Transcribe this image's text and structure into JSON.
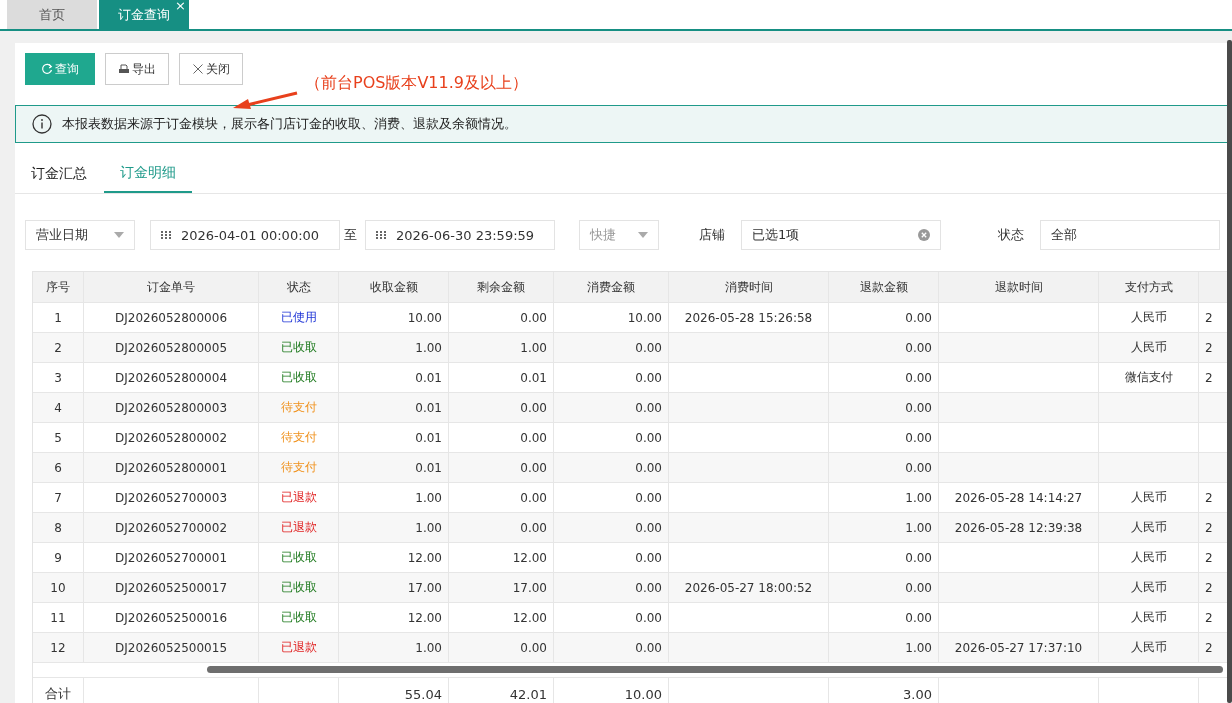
{
  "tabs": [
    {
      "label": "首页",
      "selected": false
    },
    {
      "label": "订金查询",
      "selected": true,
      "close_mark": "×"
    }
  ],
  "buttons": [
    {
      "label": "查询",
      "kind": "refresh"
    },
    {
      "label": "导出",
      "kind": "export"
    },
    {
      "label": "关闭",
      "kind": "close"
    }
  ],
  "annotation": "（前台POS版本V11.9及以上）",
  "notice": "本报表数据来源于订金模块，展示各门店订金的收取、消费、退款及余额情况。",
  "subtabs": [
    {
      "label": "订金汇总",
      "selected": false
    },
    {
      "label": "订金明细",
      "selected": true
    }
  ],
  "filters": {
    "date_type": "营业日期",
    "start": "2026-04-01 00:00:00",
    "separator": "至",
    "end": "2026-06-30 23:59:59",
    "quick": {
      "placeholder": "快捷"
    },
    "store": {
      "label": "店铺",
      "value": "已选1项"
    },
    "status": {
      "label": "状态",
      "value": "全部"
    }
  },
  "table": {
    "columns": [
      "序号",
      "订金单号",
      "状态",
      "收取金额",
      "剩余金额",
      "消费金额",
      "消费时间",
      "退款金额",
      "退款时间",
      "支付方式"
    ],
    "rows": [
      {
        "no": "1",
        "order": "DJ2026052800006",
        "status": "已使用",
        "kind": "used",
        "received": "10.00",
        "remaining": "0.00",
        "consumed": "10.00",
        "consume_time": "2026-05-28 15:26:58",
        "refund": "0.00",
        "payment": "人民币",
        "column_11": "2"
      },
      {
        "no": "2",
        "order": "DJ2026052800005",
        "status": "已收取",
        "kind": "received",
        "received": "1.00",
        "remaining": "1.00",
        "consumed": "0.00",
        "refund": "0.00",
        "payment": "人民币",
        "column_11": "2"
      },
      {
        "no": "3",
        "order": "DJ2026052800004",
        "status": "已收取",
        "kind": "received",
        "received": "0.01",
        "remaining": "0.01",
        "consumed": "0.00",
        "refund": "0.00",
        "payment": "微信支付",
        "column_11": "2"
      },
      {
        "no": "4",
        "order": "DJ2026052800003",
        "status": "待支付",
        "kind": "pending",
        "received": "0.01",
        "remaining": "0.00",
        "consumed": "0.00",
        "refund": "0.00"
      },
      {
        "no": "5",
        "order": "DJ2026052800002",
        "status": "待支付",
        "kind": "pending",
        "received": "0.01",
        "remaining": "0.00",
        "consumed": "0.00",
        "refund": "0.00"
      },
      {
        "no": "6",
        "order": "DJ2026052800001",
        "status": "待支付",
        "kind": "pending",
        "received": "0.01",
        "remaining": "0.00",
        "consumed": "0.00",
        "refund": "0.00"
      },
      {
        "no": "7",
        "order": "DJ2026052700003",
        "status": "已退款",
        "kind": "refunded",
        "received": "1.00",
        "remaining": "0.00",
        "consumed": "0.00",
        "refund": "1.00",
        "refund_time": "2026-05-28 14:14:27",
        "payment": "人民币",
        "column_11": "2"
      },
      {
        "no": "8",
        "order": "DJ2026052700002",
        "status": "已退款",
        "kind": "refunded",
        "received": "1.00",
        "remaining": "0.00",
        "consumed": "0.00",
        "refund": "1.00",
        "refund_time": "2026-05-28 12:39:38",
        "payment": "人民币",
        "column_11": "2"
      },
      {
        "no": "9",
        "order": "DJ2026052700001",
        "status": "已收取",
        "kind": "received",
        "received": "12.00",
        "remaining": "12.00",
        "consumed": "0.00",
        "refund": "0.00",
        "payment": "人民币",
        "column_11": "2"
      },
      {
        "no": "10",
        "order": "DJ2026052500017",
        "status": "已收取",
        "kind": "received",
        "received": "17.00",
        "remaining": "17.00",
        "consumed": "0.00",
        "consume_time": "2026-05-27 18:00:52",
        "refund": "0.00",
        "payment": "人民币",
        "column_11": "2"
      },
      {
        "no": "11",
        "order": "DJ2026052500016",
        "status": "已收取",
        "kind": "received",
        "received": "12.00",
        "remaining": "12.00",
        "consumed": "0.00",
        "refund": "0.00",
        "payment": "人民币",
        "column_11": "2"
      },
      {
        "no": "12",
        "order": "DJ2026052500015",
        "status": "已退款",
        "kind": "refunded",
        "received": "1.00",
        "remaining": "0.00",
        "consumed": "0.00",
        "refund": "1.00",
        "refund_time": "2026-05-27 17:37:10",
        "payment": "人民币",
        "column_11": "2"
      }
    ],
    "total": {
      "label": "合计",
      "received": "55.04",
      "remaining": "42.01",
      "consumed": "10.00",
      "refund": "3.00"
    }
  }
}
